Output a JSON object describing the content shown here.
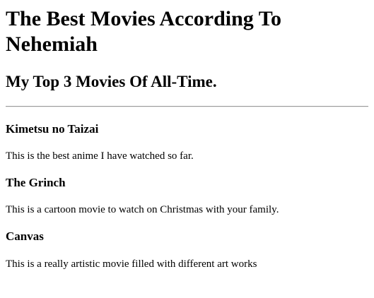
{
  "page": {
    "title": "The Best Movies According To Nehemiah",
    "subtitle": "My Top 3 Movies Of All-Time."
  },
  "movies": [
    {
      "name": "Kimetsu no Taizai",
      "description": "This is the best anime I have watched so far."
    },
    {
      "name": "The Grinch",
      "description": "This is a cartoon movie to watch on Christmas with your family."
    },
    {
      "name": "Canvas",
      "description": "This is a really artistic movie filled with different art works"
    }
  ],
  "colors": {
    "text": "#000000",
    "background": "#ffffff",
    "divider": "#9a9a9a"
  }
}
